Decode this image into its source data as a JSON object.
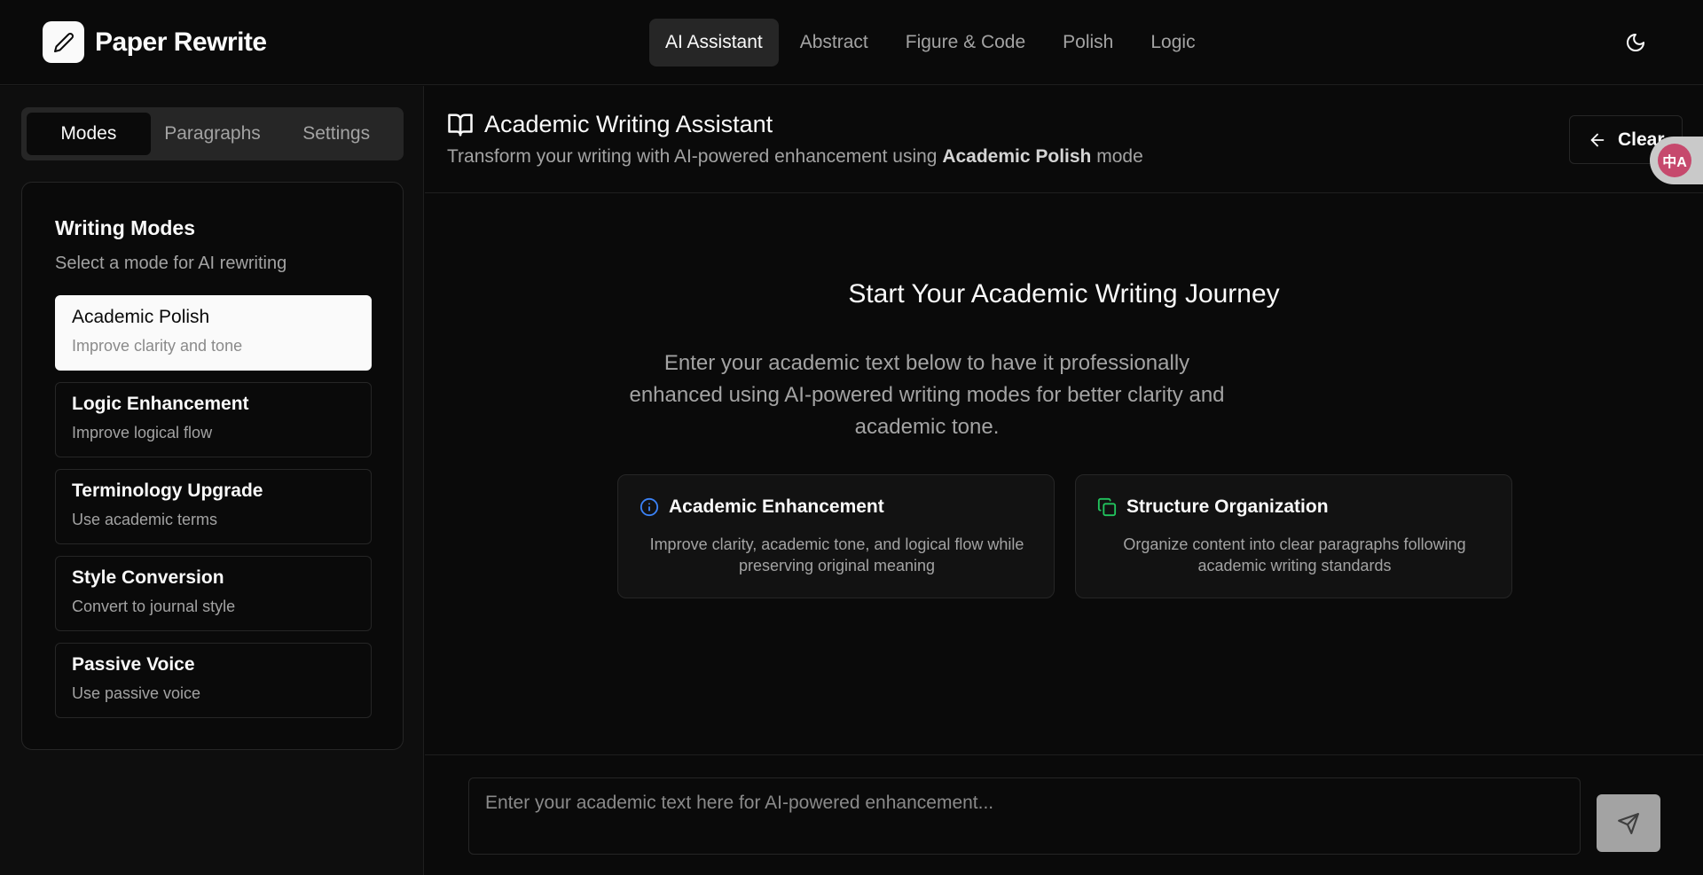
{
  "app": {
    "name": "Paper Rewrite"
  },
  "topnav": {
    "items": [
      {
        "label": "AI Assistant",
        "active": true
      },
      {
        "label": "Abstract"
      },
      {
        "label": "Figure & Code"
      },
      {
        "label": "Polish"
      },
      {
        "label": "Logic"
      }
    ]
  },
  "sidebar": {
    "tabs": [
      {
        "label": "Modes",
        "active": true
      },
      {
        "label": "Paragraphs"
      },
      {
        "label": "Settings"
      }
    ],
    "modes_title": "Writing Modes",
    "modes_subtitle": "Select a mode for AI rewriting",
    "modes": [
      {
        "name": "Academic Polish",
        "desc": "Improve clarity and tone",
        "active": true
      },
      {
        "name": "Logic Enhancement",
        "desc": "Improve logical flow"
      },
      {
        "name": "Terminology Upgrade",
        "desc": "Use academic terms"
      },
      {
        "name": "Style Conversion",
        "desc": "Convert to journal style"
      },
      {
        "name": "Passive Voice",
        "desc": "Use passive voice"
      }
    ]
  },
  "main": {
    "title": "Academic Writing Assistant",
    "subtitle_prefix": "Transform your writing with AI-powered enhancement using ",
    "subtitle_mode": "Academic Polish",
    "subtitle_suffix": " mode",
    "clear_label": "Clear",
    "empty_title": "Start Your Academic Writing Journey",
    "empty_desc": "Enter your academic text below to have it professionally enhanced using AI-powered writing modes for better clarity and academic tone.",
    "features": [
      {
        "title": "Academic Enhancement",
        "desc": "Improve clarity, academic tone, and logical flow while preserving original meaning",
        "icon": "info-icon",
        "color": "#3b82f6"
      },
      {
        "title": "Structure Organization",
        "desc": "Organize content into clear paragraphs following academic writing standards",
        "icon": "copy-icon",
        "color": "#22c55e"
      }
    ],
    "input_placeholder": "Enter your academic text here for AI-powered enhancement...",
    "translate_badge": "中A"
  },
  "icons": {
    "logo": "pencil-icon",
    "theme": "moon-icon",
    "header": "book-open-icon",
    "clear": "arrow-left-icon",
    "send": "send-icon"
  }
}
